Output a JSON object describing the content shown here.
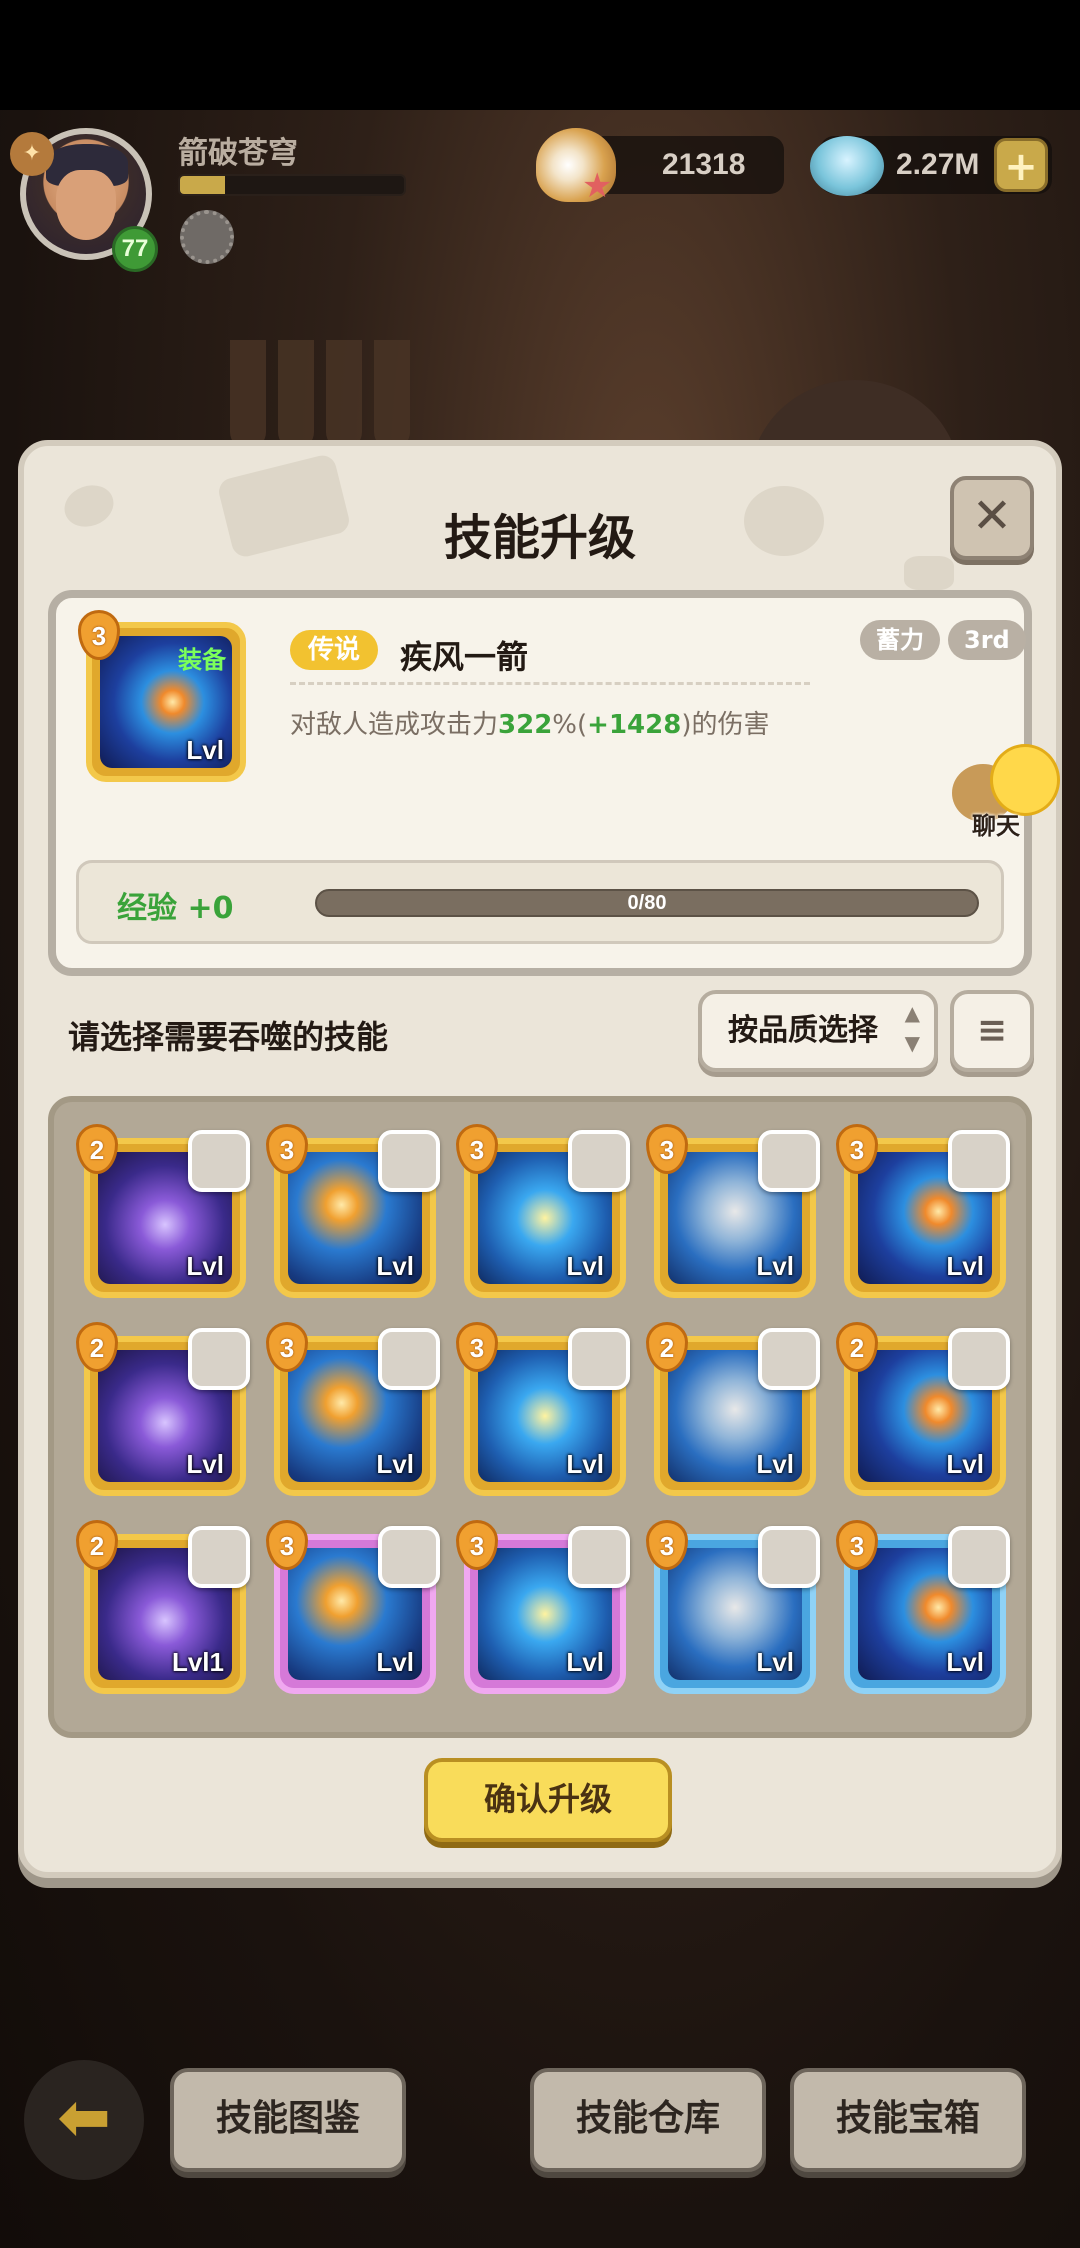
{
  "hud": {
    "player_name": "箭破苍穹",
    "level": "77",
    "xp_fraction": 0.2,
    "shells": "21318",
    "pearls": "2.27M",
    "plus_label": "+"
  },
  "dialog": {
    "title": "技能升级",
    "close_label": "✕"
  },
  "skill": {
    "tier": "3",
    "equip_tag": "装备",
    "level": "Lvl",
    "rarity": "传说",
    "name": "疾风一箭",
    "desc_prefix": "对敌人造成攻击力",
    "desc_percent": "322",
    "desc_pct_sign": "%(",
    "desc_bonus": "+1428",
    "desc_suffix": ")的伤害",
    "tag_charge": "蓄力",
    "tag_order": "3rd",
    "chat_label": "聊天",
    "exp_label": "经验 +0",
    "exp_value": "0/80",
    "exp_fraction": 0
  },
  "selection": {
    "prompt": "请选择需要吞噬的技能",
    "quality_button": "按品质选择",
    "quality_arrows": "▲▼",
    "sort_icon": "≡"
  },
  "grid_items": [
    {
      "tier": "2",
      "level": "Lvl",
      "frame": "gold"
    },
    {
      "tier": "3",
      "level": "Lvl",
      "frame": "gold"
    },
    {
      "tier": "3",
      "level": "Lvl",
      "frame": "gold"
    },
    {
      "tier": "3",
      "level": "Lvl",
      "frame": "gold"
    },
    {
      "tier": "3",
      "level": "Lvl",
      "frame": "gold"
    },
    {
      "tier": "2",
      "level": "Lvl",
      "frame": "gold"
    },
    {
      "tier": "3",
      "level": "Lvl",
      "frame": "gold"
    },
    {
      "tier": "3",
      "level": "Lvl",
      "frame": "gold"
    },
    {
      "tier": "2",
      "level": "Lvl",
      "frame": "gold"
    },
    {
      "tier": "2",
      "level": "Lvl",
      "frame": "gold"
    },
    {
      "tier": "2",
      "level": "Lvl1",
      "frame": "gold"
    },
    {
      "tier": "3",
      "level": "Lvl",
      "frame": "purple"
    },
    {
      "tier": "3",
      "level": "Lvl",
      "frame": "purple"
    },
    {
      "tier": "3",
      "level": "Lvl",
      "frame": "blue"
    },
    {
      "tier": "3",
      "level": "Lvl",
      "frame": "blue"
    }
  ],
  "confirm_button": "确认升级",
  "nav": {
    "back_icon": "⬅",
    "codex": "技能图鉴",
    "storage": "技能仓库",
    "chest": "技能宝箱"
  },
  "icon_palettes": [
    "radial-gradient(circle at 50% 55%, #d8c4ff 0%, #8a5ad8 25%, #3a2a8a 60%, #1a1440 100%)",
    "radial-gradient(circle at 40% 40%, #ffe9a8 0%, #f0a030 14%, #2a7ad0 40%, #173a80 75%, #0d1f4a 100%)",
    "radial-gradient(circle at 50% 50%, #fff3a0 0%, #3aa8f0 30%, #1e5eb0 65%, #0f2a60 100%)",
    "radial-gradient(circle at 50% 45%, #e8e8e8 0%, #8fb4d8 30%, #2a6ec0 60%, #12306a 100%)",
    "radial-gradient(circle at 60% 45%, #ffe9a8 0%, #f08a2c 12%, #2c8fe0 32%, #1d3f9e 60%, #101b52 100%)"
  ]
}
